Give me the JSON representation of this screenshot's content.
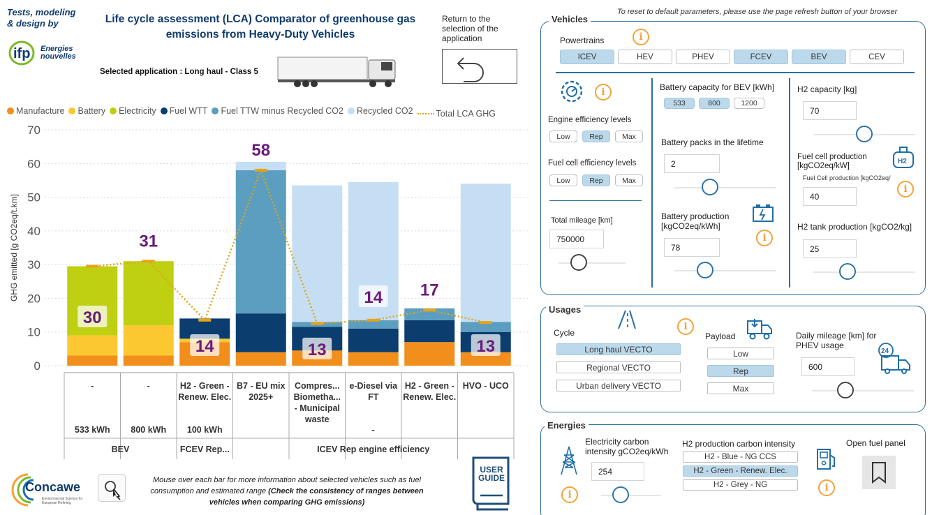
{
  "header": {
    "tests_label": "Tests, modeling & design by",
    "ifp_logo_text": "Energies nouvelles",
    "title": "Life cycle assessment (LCA) Comparator of greenhouse gas emissions from Heavy-Duty Vehicles",
    "selected_application": "Selected application : Long haul - Class 5",
    "return_label": "Return to the selection of the application",
    "reset_note": "To reset to default parameters, please use the page refresh button of your browser"
  },
  "chart_data": {
    "type": "bar",
    "stacked": true,
    "ylabel": "GHG emitted [g CO2eq/t.km]",
    "ylim": [
      0,
      70
    ],
    "yticks": [
      0,
      10,
      20,
      30,
      40,
      50,
      60,
      70
    ],
    "grid": true,
    "legend_position": "top",
    "categories": [
      "-",
      "-",
      "H2 - Green - Renew. Elec.",
      "B7 - EU mix 2025+",
      "Compres... Biometha... - Municipal waste",
      "e-Diesel via FT",
      "H2 - Green - Renew. Elec.",
      "HVO - UCO"
    ],
    "category_level2": [
      "533 kWh",
      "800 kWh",
      "100 kWh",
      "",
      "",
      "-",
      "",
      ""
    ],
    "groups": [
      {
        "label": "BEV",
        "span": 2
      },
      {
        "label": "FCEV Rep...",
        "span": 1
      },
      {
        "label": "ICEV Rep engine efficiency",
        "span": 5
      }
    ],
    "series": [
      {
        "name": "Manufacture",
        "color": "#f28e1c",
        "values": [
          3,
          3,
          7,
          4,
          4.5,
          4,
          7,
          4
        ]
      },
      {
        "name": "Battery",
        "color": "#fcc831",
        "values": [
          6,
          9,
          1,
          0,
          0,
          0,
          0,
          0
        ]
      },
      {
        "name": "Electricity",
        "color": "#bfcf11",
        "values": [
          20.5,
          19,
          0,
          0,
          0,
          0,
          0,
          0
        ]
      },
      {
        "name": "Fuel WTT",
        "color": "#0b3d6f",
        "values": [
          0,
          0,
          6,
          11.5,
          7,
          7,
          6.5,
          6
        ]
      },
      {
        "name": "Fuel TTW minus Recycled CO2",
        "color": "#5b9ec0",
        "values": [
          0,
          0,
          0,
          42.5,
          1.5,
          2.5,
          3.5,
          3
        ]
      },
      {
        "name": "Recycled CO2",
        "color": "#c6def3",
        "values": [
          0,
          0,
          0,
          2.5,
          40.5,
          41,
          0,
          41
        ]
      }
    ],
    "line_series": {
      "name": "Total LCA GHG",
      "color": "#e0a31a",
      "values": [
        29.5,
        31,
        13.5,
        58,
        12.5,
        13.5,
        16.5,
        12.8
      ]
    },
    "data_labels": [
      "30",
      "31",
      "14",
      "58",
      "13",
      "14",
      "17",
      "13"
    ]
  },
  "footer": {
    "concawe_text": "Concawe",
    "concawe_sub": "Environmental Science for European Refining",
    "hint_text": "Mouse over each bar for more information about selected vehicles such as fuel consumption and estimated range",
    "hint_bold": "(Check the consistency of ranges between vehicles when comparing GHG emissions)",
    "user_guide": "USER GUIDE"
  },
  "vehicles": {
    "title": "Vehicles",
    "powertrains_label": "Powertrains",
    "powertrains": [
      {
        "label": "ICEV",
        "selected": true
      },
      {
        "label": "HEV",
        "selected": false
      },
      {
        "label": "PHEV",
        "selected": false
      },
      {
        "label": "FCEV",
        "selected": true
      },
      {
        "label": "BEV",
        "selected": true
      },
      {
        "label": "CEV",
        "selected": false
      }
    ],
    "engine_eff_label": "Engine efficiency levels",
    "engine_levels": [
      {
        "label": "Low",
        "selected": false
      },
      {
        "label": "Rep",
        "selected": true
      },
      {
        "label": "Max",
        "selected": false
      }
    ],
    "fuelcell_eff_label": "Fuel cell efficiency levels",
    "fuelcell_levels": [
      {
        "label": "Low",
        "selected": false
      },
      {
        "label": "Rep",
        "selected": true
      },
      {
        "label": "Max",
        "selected": false
      }
    ],
    "total_mileage_label": "Total mileage [km]",
    "total_mileage_value": "750000",
    "battery_capacity_label": "Battery capacity for BEV [kWh]",
    "battery_capacities": [
      {
        "label": "533",
        "selected": true
      },
      {
        "label": "800",
        "selected": true
      },
      {
        "label": "1200",
        "selected": false
      }
    ],
    "battery_packs_label": "Battery packs in the lifetime",
    "battery_packs_value": "2",
    "battery_production_label": "Battery production [kgCO2eq/kWh]",
    "battery_production_value": "78",
    "h2_capacity_label": "H2 capacity [kg]",
    "h2_capacity_value": "70",
    "fuel_cell_production_label": "Fuel cell production [kgCO2eq/kW]",
    "fuel_cell_production_sub": "Fuel Cell production [kgCO2eq/",
    "fuel_cell_production_value": "40",
    "h2_tank_label": "H2 tank production [kgCO2/kg]",
    "h2_tank_value": "25"
  },
  "usages": {
    "title": "Usages",
    "cycle_label": "Cycle",
    "cycles": [
      {
        "label": "Long haul VECTO",
        "selected": true
      },
      {
        "label": "Regional VECTO",
        "selected": false
      },
      {
        "label": "Urban delivery VECTO",
        "selected": false
      }
    ],
    "payload_label": "Payload",
    "payloads": [
      {
        "label": "Low",
        "selected": false
      },
      {
        "label": "Rep",
        "selected": true
      },
      {
        "label": "Max",
        "selected": false
      }
    ],
    "daily_mileage_label": "Daily mileage [km] for PHEV usage",
    "daily_mileage_value": "600",
    "daily_icon_text": "24"
  },
  "energies": {
    "title": "Energies",
    "elec_label": "Electricity carbon intensity gCO2eq/kWh",
    "elec_value": "254",
    "h2_label": "H2 production carbon intensity",
    "h2_options": [
      {
        "label": "H2 - Blue - NG CCS",
        "selected": false
      },
      {
        "label": "H2 - Green - Renew. Elec.",
        "selected": true
      },
      {
        "label": "H2 - Grey - NG",
        "selected": false
      }
    ],
    "open_fuel_label": "Open fuel panel"
  }
}
